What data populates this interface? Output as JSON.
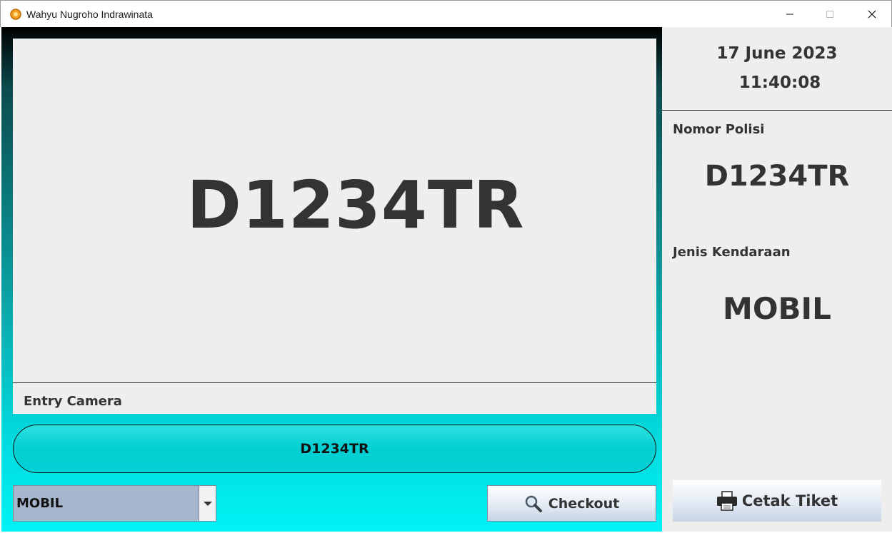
{
  "window": {
    "title": "Wahyu Nugroho Indrawinata",
    "icons": {
      "app": "java-cup-icon",
      "minimize": "minimize-icon",
      "maximize": "maximize-icon",
      "close": "close-icon"
    }
  },
  "camera": {
    "plate": "D1234TR",
    "label": "Entry Camera"
  },
  "plate_field": {
    "value": "D1234TR"
  },
  "vehicle_select": {
    "value": "MOBIL",
    "icon": "chevron-down-icon"
  },
  "checkout_button": {
    "label": "Checkout",
    "icon": "magnifier-icon"
  },
  "info": {
    "date": "17 June 2023",
    "time": "11:40:08",
    "plate_label": "Nomor Polisi",
    "plate_value": "D1234TR",
    "type_label": "Jenis Kendaraan",
    "type_value": "MOBIL"
  },
  "print_button": {
    "label": "Cetak Tiket",
    "icon": "printer-icon"
  },
  "colors": {
    "accent": "#02d1d4",
    "panel": "#eeeeee",
    "text": "#333333",
    "select": "#a6b6cc"
  }
}
